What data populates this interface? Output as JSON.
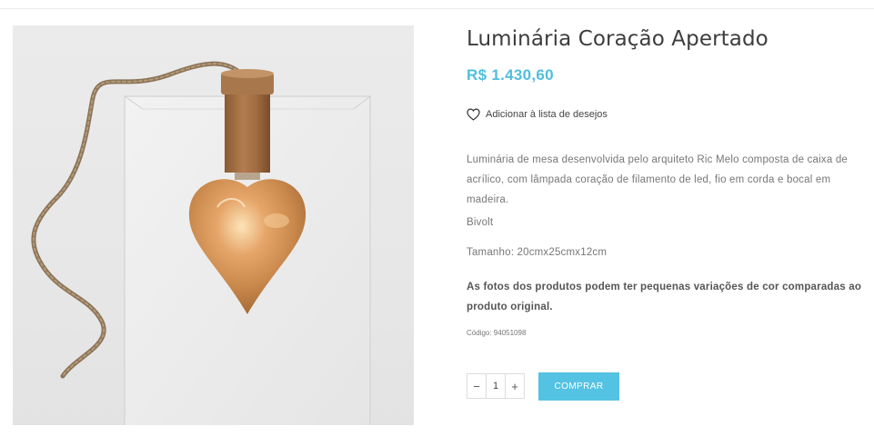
{
  "product": {
    "title": "Luminária Coração Apertado",
    "price": "R$ 1.430,60",
    "wishlist_label": "Adicionar à lista de desejos",
    "description": "Luminária de mesa desenvolvida pelo arquiteto Ric Melo composta de caixa de acrílico, com lâmpada coração de filamento de led, fio em corda e bocal em madeira.",
    "voltage": "Bivolt",
    "size": "Tamanho: 20cmx25cmx12cm",
    "notice": "As fotos dos produtos podem ter pequenas variações de cor comparadas ao produto original.",
    "sku": "Código: 94051098"
  },
  "purchase": {
    "minus_label": "−",
    "quantity": "1",
    "plus_label": "+",
    "buy_label": "COMPRAR"
  },
  "colors": {
    "accent": "#54c2e3",
    "price": "#4fbfdd",
    "text": "#777777"
  },
  "icons": {
    "wishlist": "heart-outline-icon"
  }
}
